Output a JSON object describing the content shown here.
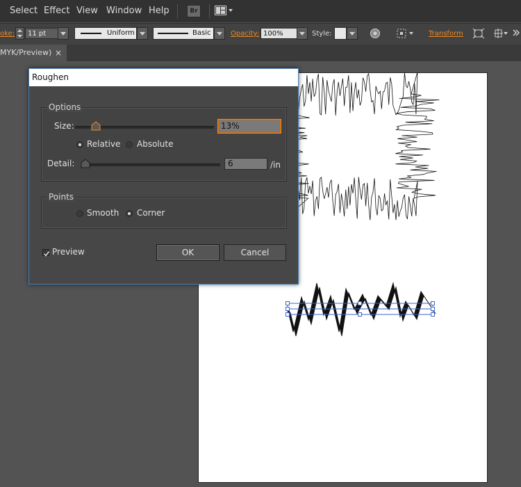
{
  "menubar": {
    "items": [
      "Select",
      "Effect",
      "View",
      "Window",
      "Help"
    ],
    "bridge_label": "Br"
  },
  "controlbar": {
    "stroke_label": "oke:",
    "stroke_weight": "11 pt",
    "profile_label": "Uniform",
    "brush_label": "Basic",
    "opacity_label": "Opacity:",
    "opacity_value": "100%",
    "style_label": "Style:",
    "transform_label": "Transform"
  },
  "tab": {
    "label": "MYK/Preview)",
    "close": "×"
  },
  "dialog": {
    "title": "Roughen",
    "options": {
      "title": "Options",
      "size_label": "Size:",
      "size_value": "13%",
      "size_fraction": 0.15,
      "relative_label": "Relative",
      "absolute_label": "Absolute",
      "detail_label": "Detail:",
      "detail_value": "6",
      "detail_fraction": 0.03,
      "detail_unit": "/in"
    },
    "points": {
      "title": "Points",
      "smooth_label": "Smooth",
      "corner_label": "Corner"
    },
    "preview_label": "Preview",
    "ok_label": "OK",
    "cancel_label": "Cancel"
  }
}
